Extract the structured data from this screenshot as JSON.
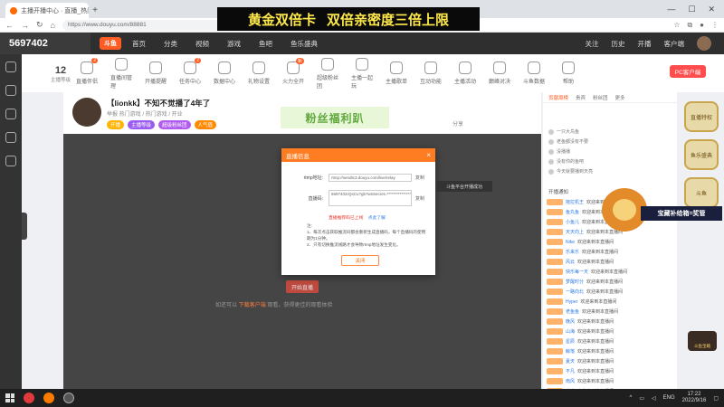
{
  "browser": {
    "tab_title": "主播开播中心 · 直播_热门游戏",
    "tab_close": "×",
    "new_tab": "+",
    "url": "https://www.douyu.com/88881",
    "win_min": "—",
    "win_max": "☐",
    "win_close": "✕"
  },
  "banner": {
    "left": "黄金双倍卡",
    "right": "双倍亲密度三倍上限"
  },
  "site": {
    "room_id": "5697402",
    "logo": "斗鱼",
    "nav": [
      "首页",
      "分类",
      "视频",
      "游戏",
      "鱼吧",
      "鱼乐盛典"
    ],
    "right": [
      "关注",
      "历史",
      "开播",
      "客户端"
    ]
  },
  "toolbar": {
    "level": "12",
    "level_label": "主播等级",
    "items": [
      {
        "label": "直播伴侣",
        "badge": "2"
      },
      {
        "label": "直播间管理",
        "badge": ""
      },
      {
        "label": "开播提醒",
        "badge": ""
      },
      {
        "label": "任务中心",
        "badge": "2"
      },
      {
        "label": "数据中心",
        "badge": ""
      },
      {
        "label": "礼物设置",
        "badge": ""
      },
      {
        "label": "火力全开",
        "badge": "新"
      },
      {
        "label": "超级粉丝团",
        "badge": ""
      },
      {
        "label": "主播一起玩",
        "badge": ""
      },
      {
        "label": "主播歌单",
        "badge": ""
      },
      {
        "label": "互动功能",
        "badge": ""
      },
      {
        "label": "主播活动",
        "badge": ""
      },
      {
        "label": "巅峰对决",
        "badge": ""
      },
      {
        "label": "斗鱼数据",
        "badge": ""
      },
      {
        "label": "帮助",
        "badge": ""
      }
    ],
    "pc_button": "PC客户端"
  },
  "room": {
    "title": "【lionkk】不知不觉播了4年了",
    "meta": "举报  热门游戏 / 热门游戏 / 开业",
    "tags": [
      "开播",
      "主播等级",
      "超级粉丝团",
      "人气值"
    ],
    "fan_banner": "粉丝福利趴",
    "share": "分享"
  },
  "modal": {
    "title": "直播信息",
    "close": "×",
    "rtmp_label": "rtmp地址:",
    "rtmp_value": "rtmp://sendtc3.douyu.com/live/relay",
    "code_label": "直播码:",
    "code_value": "5697402rQsCu?gb?wsSecret=***************",
    "copy": "复制",
    "warn": "直播推荐码已上线",
    "warn_link": "点此了解",
    "notes_title": "注:",
    "notes": [
      "1、每次点击获取推流码都会重新生成直播码，每个直播码的使用期为1分钟。",
      "2、只有切换推流线路才会导致rtmp地址发生变化。"
    ],
    "ok": "关闭"
  },
  "tooltip": "斗鱼平台开播成功",
  "player": {
    "start": "开始直播",
    "hint_a": "如还可以",
    "hint_link": "下载客户端",
    "hint_b": "观看，获得更佳的观看体验"
  },
  "right_panel": {
    "tabs": [
      "贡献周榜",
      "贵宾",
      "粉丝团",
      "更多"
    ],
    "ranks": [
      "一只大鸟鱼",
      "老鱼都没有不要",
      "没播播",
      "没有你的鱼吧",
      "今天就要播到天亮"
    ],
    "welcome_header": "开播通知",
    "messages": [
      {
        "user": "拖拉机王",
        "text": "欢迎来到本直播间"
      },
      {
        "user": "鱼丸鱼",
        "text": "欢迎来到本直播间"
      },
      {
        "user": "小鱼儿",
        "text": "欢迎来到本直播间"
      },
      {
        "user": "天天向上",
        "text": "欢迎来到本直播间"
      },
      {
        "user": "Nike",
        "text": "欢迎来到本直播间"
      },
      {
        "user": "乐来乐",
        "text": "欢迎来到本直播间"
      },
      {
        "user": "风云",
        "text": "欢迎来到本直播间"
      },
      {
        "user": "快乐每一天",
        "text": "欢迎来到本直播间"
      },
      {
        "user": "梦醒时分",
        "text": "欢迎来到本直播间"
      },
      {
        "user": "一路向北",
        "text": "欢迎来到本直播间"
      },
      {
        "user": "Hyper",
        "text": "欢迎来到本直播间"
      },
      {
        "user": "老鱼鱼",
        "text": "欢迎来到本直播间"
      },
      {
        "user": "晚风",
        "text": "欢迎来到本直播间"
      },
      {
        "user": "山海",
        "text": "欢迎来到本直播间"
      },
      {
        "user": "星辰",
        "text": "欢迎来到本直播间"
      },
      {
        "user": "鲸落",
        "text": "欢迎来到本直播间"
      },
      {
        "user": "夏天",
        "text": "欢迎来到本直播间"
      },
      {
        "user": "不凡",
        "text": "欢迎来到本直播间"
      },
      {
        "user": "南风",
        "text": "欢迎来到本直播间"
      },
      {
        "user": "微光",
        "text": "欢迎来到本直播间"
      },
      {
        "user": "青柠",
        "text": "欢迎来到本直播间"
      }
    ]
  },
  "ads": [
    "直播特权",
    "鱼乐盛典",
    "斗鱼"
  ],
  "lion_banner": "宝藏补给箱=奖管",
  "treasure": "斗鱼宝箱",
  "taskbar": {
    "lang": "ENG",
    "time": "17:22",
    "date": "2022/9/16"
  }
}
